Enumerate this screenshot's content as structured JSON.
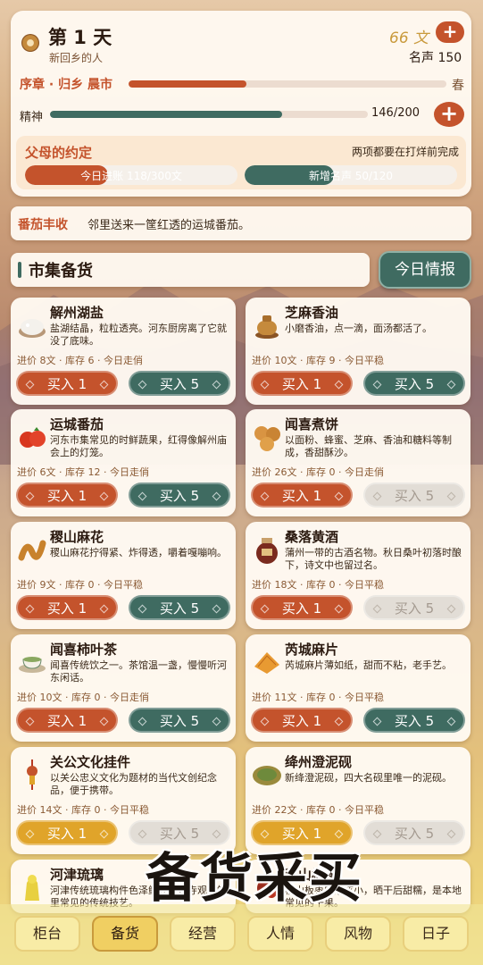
{
  "header": {
    "day": "第 1 天",
    "subtitle": "新回乡的人",
    "coins": "66 文",
    "coin_add": "+",
    "reputation": "名声 150",
    "chapter": "序章 · 归乡 晨市",
    "chapter_progress": 0.37,
    "season": "春",
    "energy_label": "精神",
    "energy_value": "146/200",
    "energy_progress": 0.73,
    "energy_add": "+"
  },
  "promise": {
    "title": "父母的约定",
    "note": "两项都要在打烊前完成",
    "goal1": "今日进账 118/300文",
    "goal1_progress": 0.39,
    "goal2": "新增名声 50/120",
    "goal2_progress": 0.42
  },
  "news": {
    "tag": "番茄丰收",
    "text": "邻里送来一筐红透的运城番茄。"
  },
  "section": {
    "title": "市集备货",
    "intel_button": "今日情报"
  },
  "buy1_label": "买入 1",
  "buy5_label": "买入 5",
  "goods": [
    {
      "name": "解州湖盐",
      "desc": "盐湖结晶，粒粒透亮。河东厨房离了它就没了底味。",
      "meta": "进价 8文 · 库存 6 · 今日走俏",
      "icon": "salt-icon"
    },
    {
      "name": "芝麻香油",
      "desc": "小磨香油，点一滴，面汤都活了。",
      "meta": "进价 10文 · 库存 9 · 今日平稳",
      "icon": "oil-jar-icon"
    },
    {
      "name": "运城番茄",
      "desc": "河东市集常见的时鲜蔬果，红得像解州庙会上的灯笼。",
      "meta": "进价 6文 · 库存 12 · 今日走俏",
      "icon": "tomato-icon"
    },
    {
      "name": "闻喜煮饼",
      "desc": "以面粉、蜂蜜、芝麻、香油和糖料等制成，香甜酥沙。",
      "meta": "进价 26文 · 库存 0 · 今日走俏",
      "icon": "cake-icon"
    },
    {
      "name": "稷山麻花",
      "desc": "稷山麻花拧得紧、炸得透，嚼着嘎嘣响。",
      "meta": "进价 9文 · 库存 0 · 今日平稳",
      "icon": "twist-icon"
    },
    {
      "name": "桑落黄酒",
      "desc": "蒲州一带的古酒名物。秋日桑叶初落时酿下，诗文中也留过名。",
      "meta": "进价 18文 · 库存 0 · 今日平稳",
      "icon": "wine-jar-icon"
    },
    {
      "name": "闻喜柿叶茶",
      "desc": "闻喜传统饮之一。茶馆温一盏，慢慢听河东闲话。",
      "meta": "进价 10文 · 库存 0 · 今日走俏",
      "icon": "tea-icon"
    },
    {
      "name": "芮城麻片",
      "desc": "芮城麻片薄如纸，甜而不粘，老手艺。",
      "meta": "进价 11文 · 库存 0 · 今日平稳",
      "icon": "sesame-crisp-icon"
    },
    {
      "name": "关公文化挂件",
      "desc": "以关公忠义文化为题材的当代文创纪念品，便于携带。",
      "meta": "进价 14文 · 库存 0 · 今日平稳",
      "icon": "pendant-icon"
    },
    {
      "name": "绛州澄泥砚",
      "desc": "新绛澄泥砚，四大名砚里唯一的泥砚。",
      "meta": "进价 22文 · 库存 0 · 今日平稳",
      "icon": "inkstone-icon"
    },
    {
      "name": "河津琉璃",
      "desc": "河津传统琉璃构件色泽鲜亮，是寺观建筑里常见的传统技艺。",
      "meta": "",
      "icon": "glaze-icon"
    },
    {
      "name": "稷山板枣",
      "desc": "稷山板枣肉厚核小，晒干后甜糯，是本地常见的干果。",
      "meta": "",
      "icon": "date-icon"
    }
  ],
  "overlay_text": "备货采买",
  "nav": [
    {
      "label": "柜台"
    },
    {
      "label": "备货"
    },
    {
      "label": "经营"
    },
    {
      "label": "人情"
    },
    {
      "label": "风物"
    },
    {
      "label": "日子"
    }
  ],
  "colors": {
    "accent_red": "#c4532c",
    "accent_green": "#3f6b61",
    "gold": "#e0a42a"
  }
}
